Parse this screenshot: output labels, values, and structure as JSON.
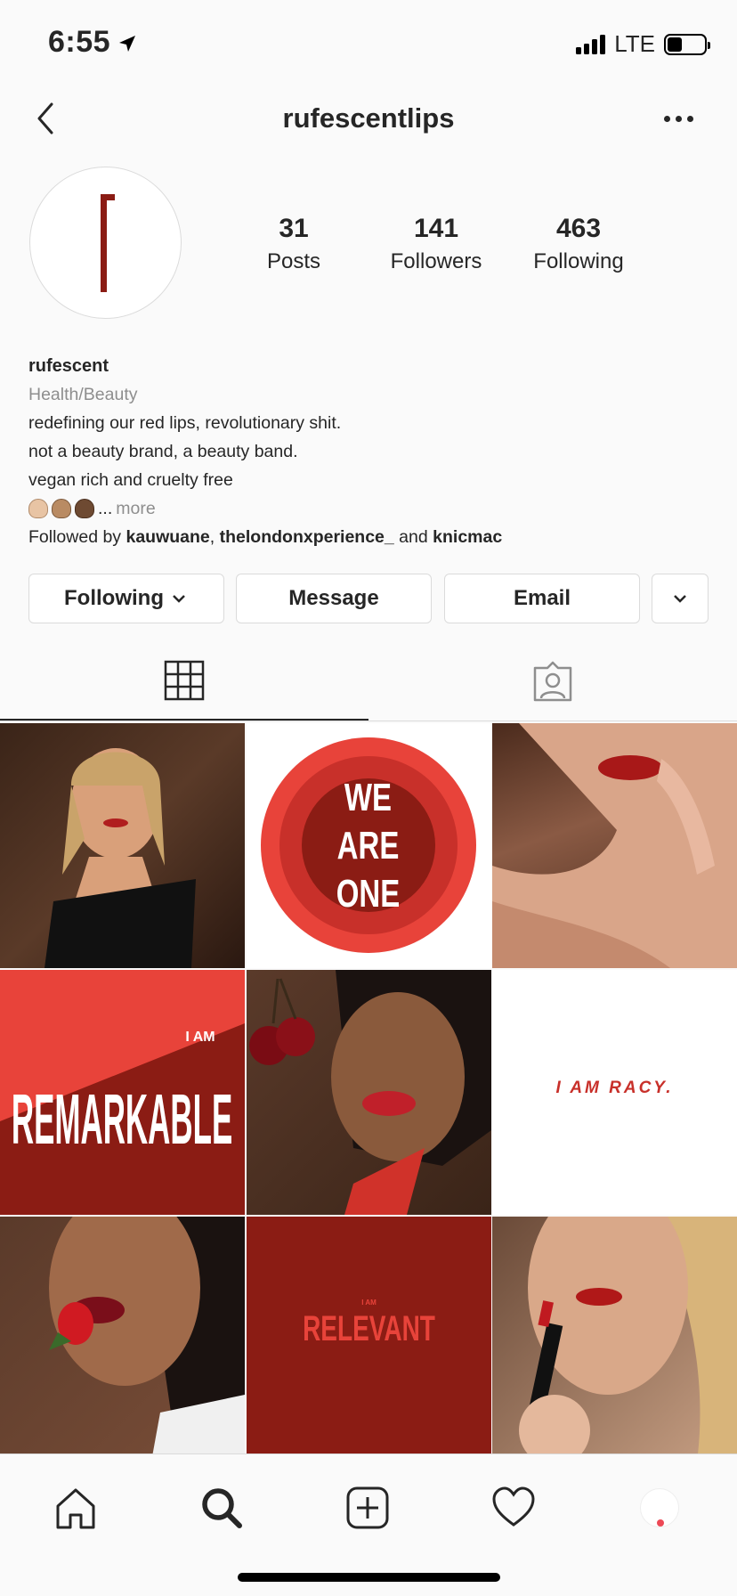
{
  "status": {
    "time": "6:55",
    "network": "LTE"
  },
  "nav": {
    "title": "rufescentlips"
  },
  "profile": {
    "stats": [
      {
        "value": "31",
        "label": "Posts"
      },
      {
        "value": "141",
        "label": "Followers"
      },
      {
        "value": "463",
        "label": "Following"
      }
    ],
    "name": "rufescent",
    "category": "Health/Beauty",
    "bio_lines": [
      "redefining our red lips, revolutionary shit.",
      "not a beauty brand, a beauty band.",
      "vegan rich and cruelty free"
    ],
    "bio_ellipsis": "...",
    "more": "more",
    "followed_by": {
      "prefix": "Followed by",
      "user1": "kauwuane",
      "sep": ",",
      "user2": "thelondonxperience_",
      "and": "and",
      "user3": "knicmac"
    }
  },
  "actions": {
    "following": "Following",
    "message": "Message",
    "email": "Email"
  },
  "posts": {
    "p2_text": [
      "WE",
      "ARE",
      "ONE"
    ],
    "p4_small": "I AM",
    "p4_big": "REMARKABLE",
    "p6_text": "I AM RACY.",
    "p8_small": "I AM",
    "p8_big": "RELEVANT"
  },
  "colors": {
    "brand_red": "#8b1c14",
    "accent_red": "#e8433a",
    "link_blue": "#003569"
  }
}
